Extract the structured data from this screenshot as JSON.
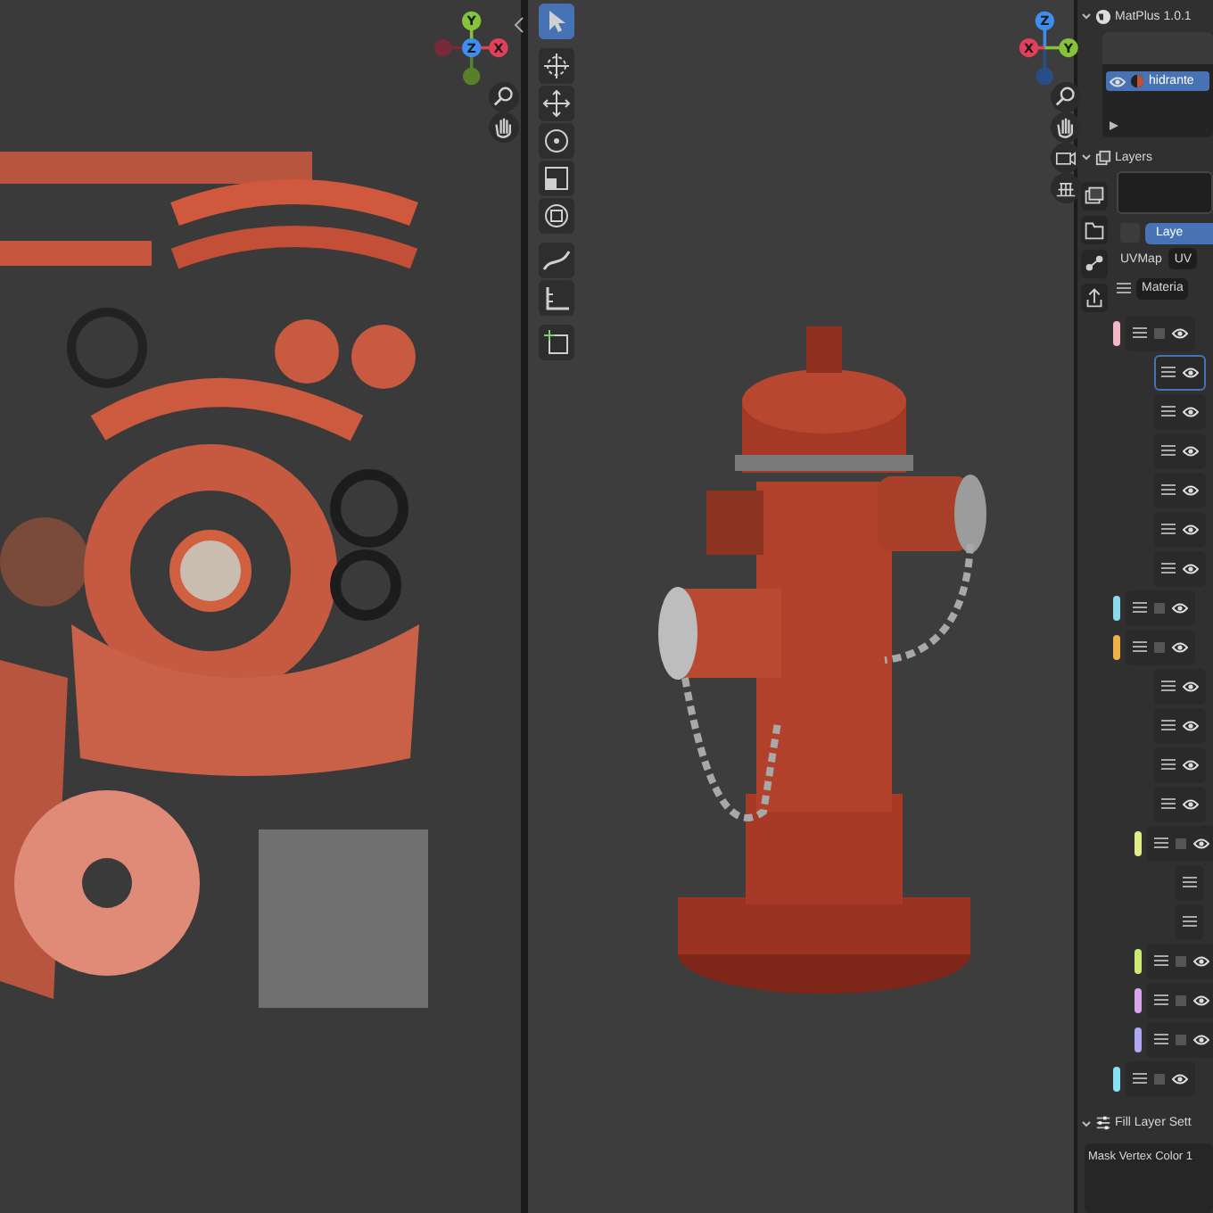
{
  "uv_editor": {
    "gizmo": [
      {
        "kind": "y",
        "label": "Y"
      },
      {
        "kind": "z",
        "label": "Z"
      },
      {
        "kind": "x",
        "label": "X"
      }
    ],
    "nav": [
      {
        "kind": "zoom"
      },
      {
        "kind": "pan"
      }
    ]
  },
  "viewport": {
    "tools": [
      {
        "kind": "select",
        "selected": true
      },
      {
        "kind": "cursor",
        "selected": false
      },
      {
        "kind": "move",
        "selected": false
      },
      {
        "kind": "rotate",
        "selected": false
      },
      {
        "kind": "scale",
        "selected": false
      },
      {
        "kind": "transform",
        "selected": false
      },
      {
        "kind": "annotate",
        "selected": false
      },
      {
        "kind": "measure",
        "selected": false
      },
      {
        "kind": "add-cube",
        "selected": false
      }
    ],
    "gizmo": [
      {
        "kind": "z",
        "label": "Z"
      },
      {
        "kind": "x",
        "label": "X"
      },
      {
        "kind": "y",
        "label": "Y"
      }
    ],
    "nav": [
      {
        "kind": "zoom"
      },
      {
        "kind": "pan"
      },
      {
        "kind": "camera"
      },
      {
        "kind": "grid"
      }
    ]
  },
  "addon_panel": {
    "title": "MatPlus 1.0.1",
    "expanded": true,
    "list": [
      {
        "name": "hidrante",
        "selected": true
      }
    ]
  },
  "layers_panel": {
    "title": "Layers",
    "expanded": true,
    "side_tabs": [
      {
        "kind": "stack"
      },
      {
        "kind": "folder"
      },
      {
        "kind": "nodes"
      },
      {
        "kind": "export"
      }
    ],
    "tab": {
      "label": "Laye",
      "selected": true
    },
    "uv_label": "UVMap",
    "uv_field": "UV",
    "material_field": "Materia",
    "layers": [
      {
        "kind": "group",
        "color": "#f2b8c8",
        "selected": false,
        "children": [
          {
            "kind": "layer",
            "selected": true
          },
          {
            "kind": "layer",
            "selected": false
          },
          {
            "kind": "layer",
            "selected": false
          },
          {
            "kind": "layer",
            "selected": false
          },
          {
            "kind": "layer",
            "selected": false
          },
          {
            "kind": "layer",
            "selected": false
          }
        ]
      },
      {
        "kind": "group",
        "color": "#8adcec",
        "selected": false
      },
      {
        "kind": "group",
        "color": "#f0b048",
        "selected": false,
        "children": [
          {
            "kind": "layer",
            "selected": false
          },
          {
            "kind": "layer",
            "selected": false
          },
          {
            "kind": "layer",
            "selected": false
          },
          {
            "kind": "layer",
            "selected": false
          },
          {
            "kind": "group",
            "color": "#e2ee88",
            "selected": false,
            "children": [
              {
                "kind": "layer",
                "selected": false
              },
              {
                "kind": "layer",
                "selected": false
              }
            ]
          },
          {
            "kind": "group",
            "color": "#cdea78",
            "selected": false
          },
          {
            "kind": "group",
            "color": "#d8a4ec",
            "selected": false
          },
          {
            "kind": "group",
            "color": "#b0a8f0",
            "selected": false
          }
        ]
      },
      {
        "kind": "group",
        "color": "#86e2f2",
        "selected": false
      }
    ]
  },
  "fill_settings": {
    "title": "Fill Layer Sett",
    "expanded": true,
    "field": "Mask Vertex Color 1"
  }
}
